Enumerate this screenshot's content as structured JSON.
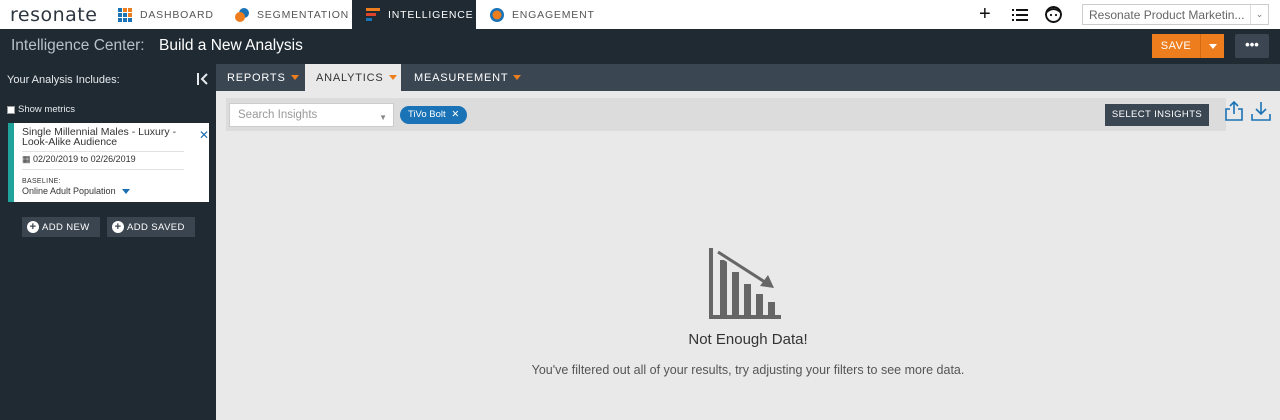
{
  "brand": {
    "logo_text": "resonate"
  },
  "nav": {
    "tabs": [
      {
        "label": "DASHBOARD",
        "icon": "dashboard-grid-icon",
        "active": false
      },
      {
        "label": "SEGMENTATION",
        "icon": "segmentation-circles-icon",
        "active": false
      },
      {
        "label": "INTELLIGENCE",
        "icon": "intelligence-bars-icon",
        "active": true
      },
      {
        "label": "ENGAGEMENT",
        "icon": "engagement-target-icon",
        "active": false
      }
    ],
    "org_select": "Resonate Product Marketin..."
  },
  "header": {
    "section": "Intelligence Center:",
    "title": "Build a New Analysis",
    "save_label": "SAVE",
    "more_label": "•••"
  },
  "sidebar": {
    "heading": "Your Analysis Includes:",
    "show_metrics": "Show metrics",
    "audience": {
      "name": "Single Millennial Males - Luxury - Look-Alike Audience",
      "dates": "02/20/2019 to 02/26/2019",
      "baseline_label": "BASELINE:",
      "baseline_value": "Online Adult Population"
    },
    "add_new": "ADD NEW",
    "add_saved": "ADD SAVED"
  },
  "tabs": [
    {
      "label": "REPORTS"
    },
    {
      "label": "ANALYTICS"
    },
    {
      "label": "MEASUREMENT"
    }
  ],
  "filters": {
    "search_placeholder": "Search Insights",
    "chip": "TiVo Bolt",
    "select_insights": "SELECT INSIGHTS"
  },
  "empty": {
    "title": "Not Enough Data!",
    "message": "You've filtered out all of your results, try adjusting your filters to see more data."
  },
  "colors": {
    "accent": "#ee7d1d",
    "dark": "#1f2a33",
    "blue": "#1a73b6",
    "teal": "#1fa39b"
  }
}
